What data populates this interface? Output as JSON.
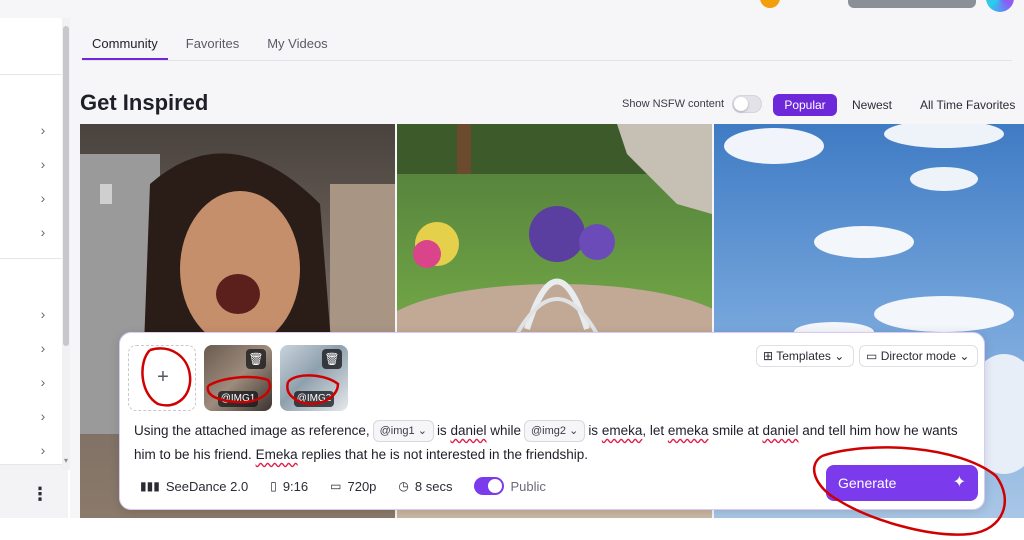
{
  "tabs": [
    {
      "label": "Community",
      "active": true
    },
    {
      "label": "Favorites",
      "active": false
    },
    {
      "label": "My Videos",
      "active": false
    }
  ],
  "page_title": "Get Inspired",
  "nsfw": {
    "label": "Show NSFW content",
    "enabled": false
  },
  "sort": {
    "popular": "Popular",
    "newest": "Newest",
    "all_time": "All Time Favorites",
    "selected": "Popular"
  },
  "sidebar": {
    "icons": [
      "chevron-right-icon",
      "chevron-right-icon",
      "chevron-right-icon",
      "chevron-right-icon",
      "chevron-right-icon",
      "chevron-right-icon",
      "chevron-right-icon",
      "chevron-right-icon",
      "chevron-right-icon"
    ],
    "more_icon": "kebab-menu-icon"
  },
  "panel": {
    "ref_images": [
      {
        "tag": "@IMG1"
      },
      {
        "tag": "@IMG2"
      }
    ],
    "templates_label": "Templates",
    "director_label": "Director mode",
    "prompt": {
      "p1": "Using the attached image as reference,",
      "chip1": "@img1",
      "p2": "is",
      "w_daniel": "daniel",
      "p3": "while",
      "chip2": "@img2",
      "p4": "is",
      "w_emeka1": "emeka",
      "p5": ", let",
      "w_emeka2": "emeka",
      "p6": "smile at",
      "w_daniel2": "daniel",
      "p7": "and tell him how he wants him to be his friend.",
      "w_emeka3": "Emeka",
      "p8": "replies that he is not interested in the friendship."
    },
    "meta": {
      "model": "SeeDance 2.0",
      "ratio": "9:16",
      "resolution": "720p",
      "duration": "8 secs",
      "visibility": "Public",
      "public_enabled": true
    },
    "generate_label": "Generate"
  },
  "colors": {
    "accent": "#7c3aed",
    "annotation": "#d00000"
  }
}
